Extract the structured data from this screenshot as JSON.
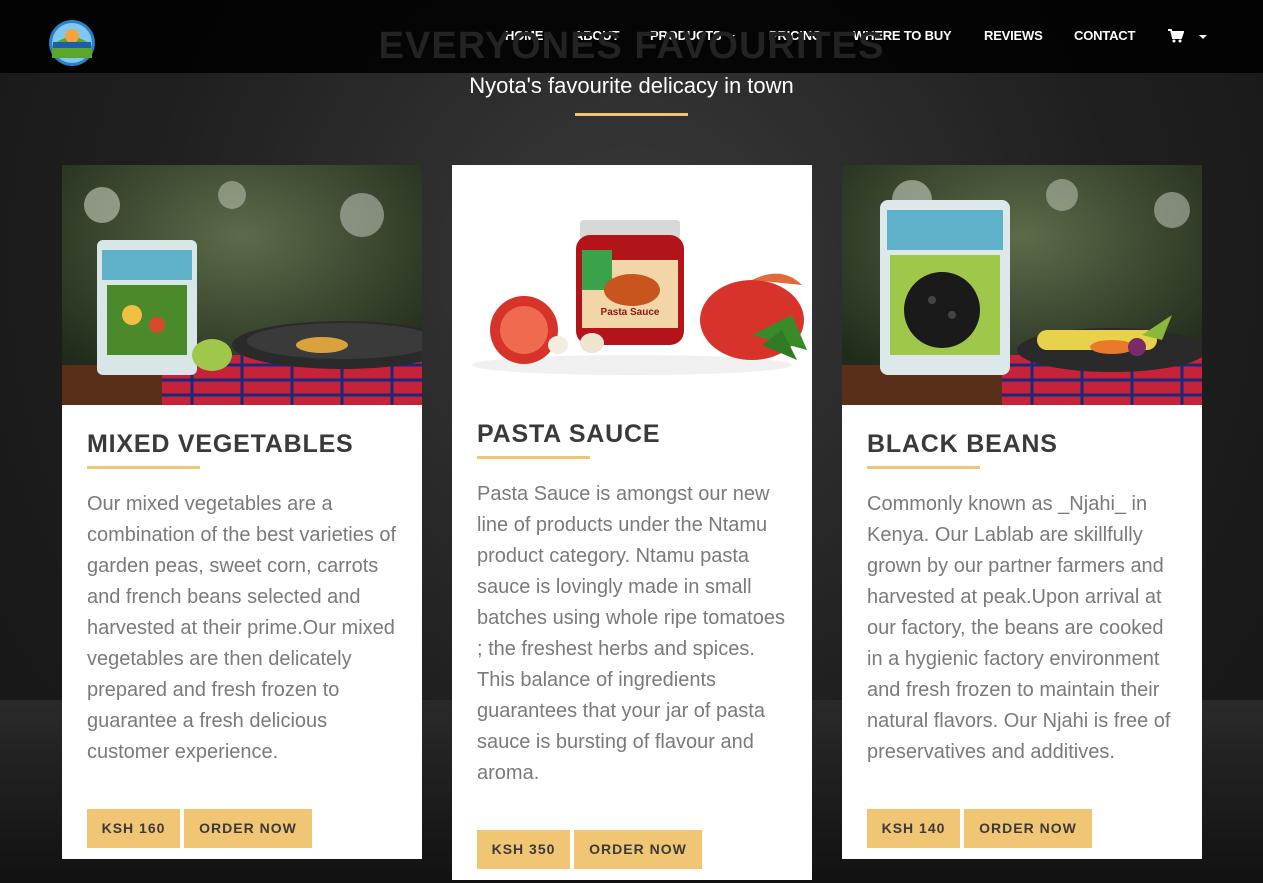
{
  "nav": {
    "items": [
      "HOME",
      "ABOUT",
      "PRODUCTS",
      "PRICING",
      "WHERE TO BUY",
      "REVIEWS",
      "CONTACT"
    ]
  },
  "header": {
    "bg_title": "EVERYONES FAVOURITES",
    "subtitle": "Nyota's favourite delicacy in town"
  },
  "cards": [
    {
      "title": "MIXED VEGETABLES",
      "description": "Our mixed vegetables are a combination of the best varieties of garden peas, sweet corn, carrots and french beans selected and harvested at their prime.Our mixed vegetables are then delicately prepared and fresh frozen to guarantee a fresh delicious customer experience.",
      "price": "KSH 160",
      "order": "ORDER NOW"
    },
    {
      "title": "PASTA SAUCE",
      "description": "Pasta Sauce is amongst our new line of products under the Ntamu product category. Ntamu pasta sauce is lovingly made in small batches using whole ripe tomatoes ; the freshest herbs and spices. This balance of ingredients guarantees that your jar of pasta sauce is bursting of flavour and aroma.",
      "price": "KSH 350",
      "order": "ORDER NOW"
    },
    {
      "title": "BLACK BEANS",
      "description": "Commonly known as _Njahi_ in Kenya. Our Lablab are skillfully grown by our partner farmers and harvested at peak.Upon arrival at our factory, the beans are cooked in a hygienic factory environment and fresh frozen to maintain their natural flavors. Our Njahi is free of preservatives and additives.",
      "price": "KSH 140",
      "order": "ORDER NOW"
    }
  ],
  "colors": {
    "accent": "#f0c674",
    "text_dark": "#3b3a38",
    "text_body": "#7a7a7a"
  },
  "icons": [
    "logo",
    "cart-icon",
    "dropdown-caret-icon"
  ]
}
